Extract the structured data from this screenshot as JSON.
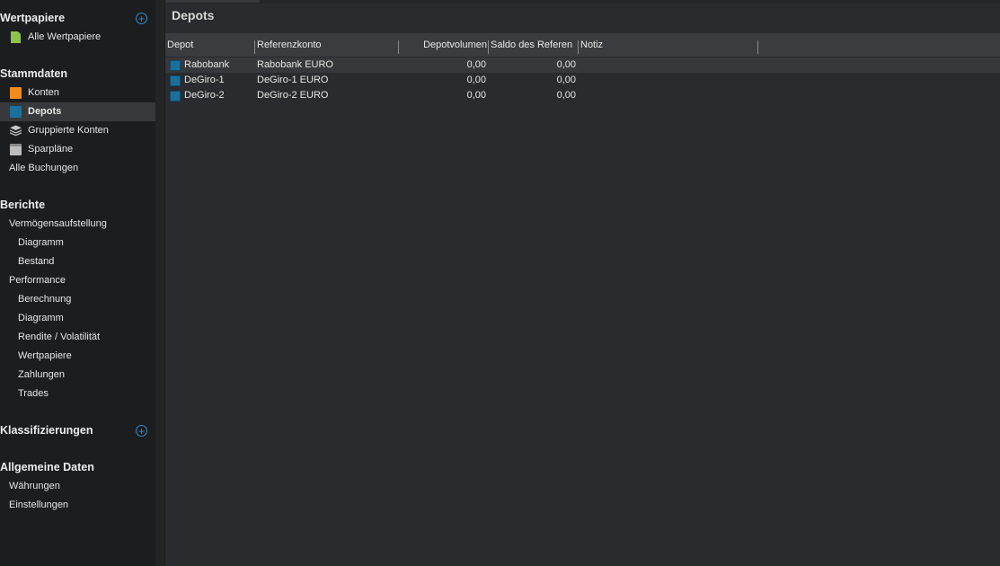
{
  "sidebar": {
    "sections": {
      "wertpapiere": {
        "title": "Wertpapiere",
        "items": [
          {
            "label": "Alle Wertpapiere",
            "icon": "document-icon"
          }
        ]
      },
      "stammdaten": {
        "title": "Stammdaten",
        "items": [
          {
            "label": "Konten",
            "icon": "account-icon"
          },
          {
            "label": "Depots",
            "icon": "depot-icon"
          },
          {
            "label": "Gruppierte Konten",
            "icon": "layers-icon"
          },
          {
            "label": "Sparpläne",
            "icon": "calendar-icon"
          },
          {
            "label": "Alle Buchungen"
          }
        ]
      },
      "berichte": {
        "title": "Berichte",
        "items": [
          {
            "label": "Vermögensaufstellung"
          },
          {
            "label": "Diagramm"
          },
          {
            "label": "Bestand"
          },
          {
            "label": "Performance"
          },
          {
            "label": "Berechnung"
          },
          {
            "label": "Diagramm"
          },
          {
            "label": "Rendite / Volatilität"
          },
          {
            "label": "Wertpapiere"
          },
          {
            "label": "Zahlungen"
          },
          {
            "label": "Trades"
          }
        ]
      },
      "klassifizierungen": {
        "title": "Klassifizierungen"
      },
      "allgemein": {
        "title": "Allgemeine Daten",
        "items": [
          {
            "label": "Währungen"
          },
          {
            "label": "Einstellungen"
          }
        ]
      }
    },
    "plus_symbol": "+"
  },
  "page": {
    "title": "Depots"
  },
  "table": {
    "columns": [
      "Depot",
      "Referenzkonto",
      "Depotvolumen",
      "Saldo des Referen",
      "Notiz"
    ],
    "rows": [
      {
        "depot": "Rabobank",
        "referenzkonto": "Rabobank EURO",
        "depotvolumen": "0,00",
        "saldo": "0,00",
        "notiz": ""
      },
      {
        "depot": "DeGiro-1",
        "referenzkonto": "DeGiro-1 EURO",
        "depotvolumen": "0,00",
        "saldo": "0,00",
        "notiz": ""
      },
      {
        "depot": "DeGiro-2",
        "referenzkonto": "DeGiro-2 EURO",
        "depotvolumen": "0,00",
        "saldo": "0,00",
        "notiz": ""
      }
    ]
  },
  "colors": {
    "accent": "#2c8fd0",
    "konten_icon": "#f08c1e",
    "depot_icon": "#1b6f9b",
    "wertpapiere_icon": "#8fc44a"
  }
}
